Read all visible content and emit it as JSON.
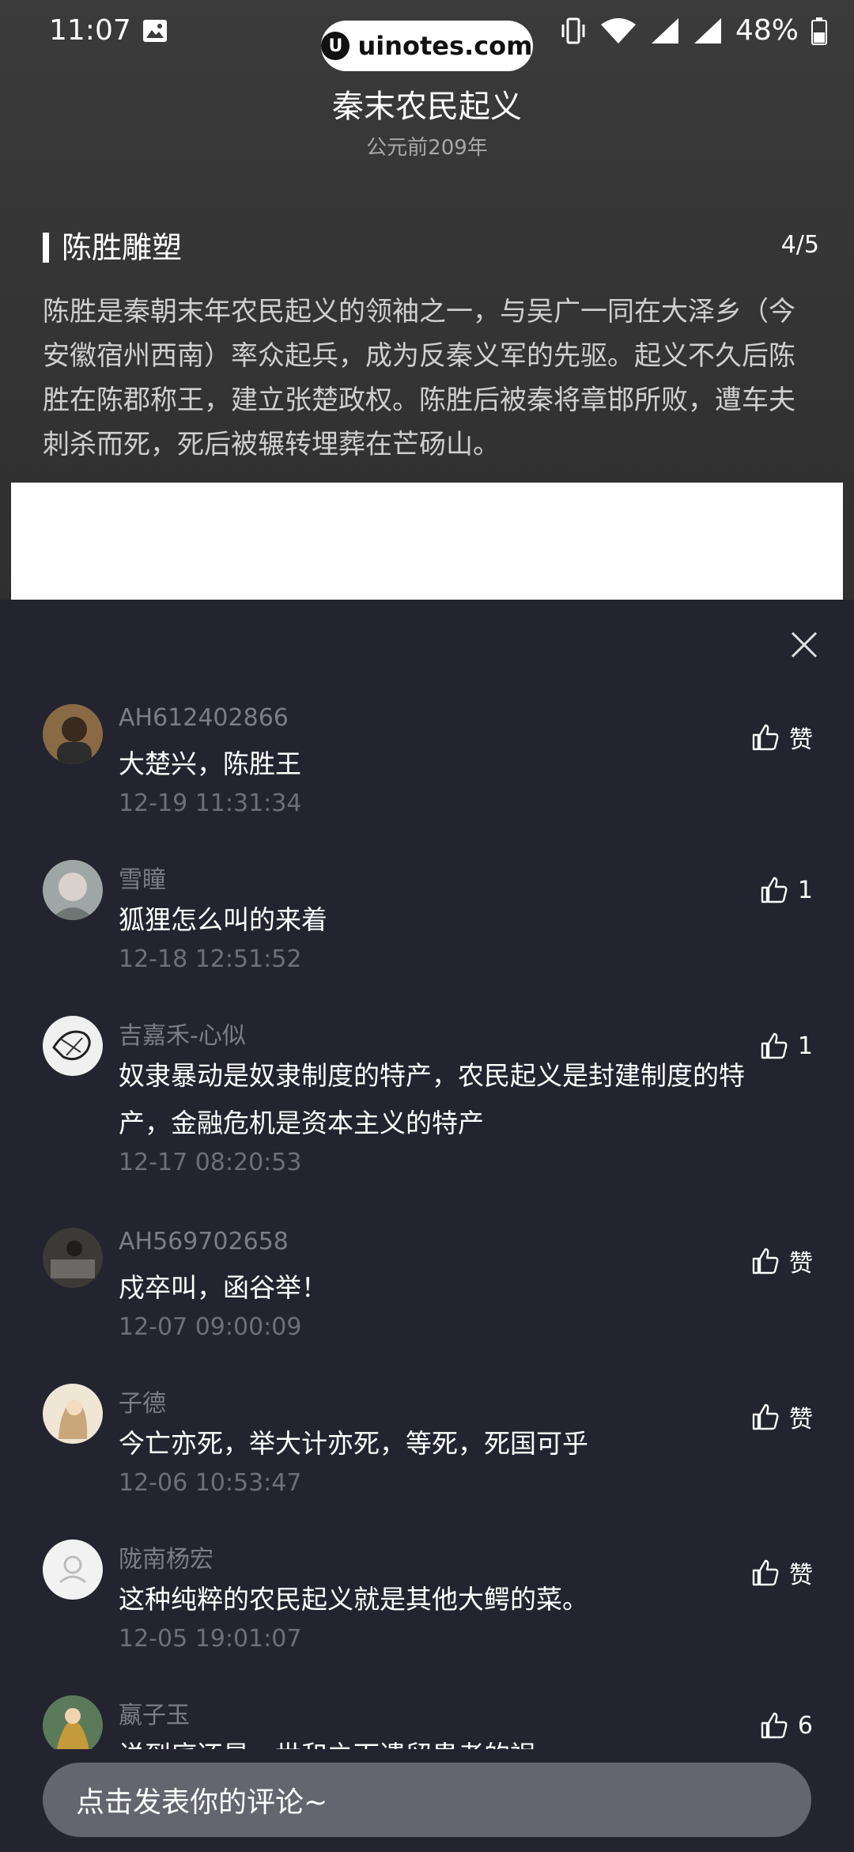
{
  "status": {
    "time": "11:07",
    "battery": "48%"
  },
  "watermark": {
    "logo": "U",
    "text": "uinotes.com"
  },
  "header": {
    "title": "秦末农民起义",
    "subtitle": "公元前209年"
  },
  "section": {
    "title": "陈胜雕塑",
    "pager": "4/5",
    "description": "陈胜是秦朝末年农民起义的领袖之一，与吴广一同在大泽乡（今安徽宿州西南）率众起兵，成为反秦义军的先驱。起义不久后陈胜在陈郡称王，建立张楚政权。陈胜后被秦将章邯所败，遭车夫刺杀而死，死后被辗转埋葬在芒砀山。"
  },
  "comments": [
    {
      "user": "AH612402866",
      "text": "大楚兴，陈胜王",
      "time": "12-19 11:31:34",
      "like": "赞",
      "avatar_color": "#8a6a45"
    },
    {
      "user": "雪瞳",
      "text": "狐狸怎么叫的来着",
      "time": "12-18 12:51:52",
      "like": "1",
      "avatar_color": "#9fa7a6"
    },
    {
      "user": "吉嘉禾-心似",
      "text": "奴隶暴动是奴隶制度的特产，农民起义是封建制度的特产，金融危机是资本主义的特产",
      "time": "12-17 08:20:53",
      "like": "1",
      "avatar_color": "#e8e8e8"
    },
    {
      "user": "AH569702658",
      "text": "戍卒叫，函谷举！",
      "time": "12-07 09:00:09",
      "like": "赞",
      "avatar_color": "#3c3a36"
    },
    {
      "user": "子德",
      "text": "今亡亦死，举大计亦死，等死，死国可乎",
      "time": "12-06 10:53:47",
      "like": "赞",
      "avatar_color": "#d9c7a8"
    },
    {
      "user": "陇南杨宏",
      "text": "这种纯粹的农民起义就是其他大鳄的菜。",
      "time": "12-05 19:01:07",
      "like": "赞",
      "avatar_color": "#f2f2f2"
    },
    {
      "user": "嬴子玉",
      "text": "说到底还是，世和之下遗留患者的祸",
      "time": "",
      "like": "6",
      "avatar_color": "#5b7a5a"
    }
  ],
  "input": {
    "placeholder": "点击发表你的评论~"
  }
}
